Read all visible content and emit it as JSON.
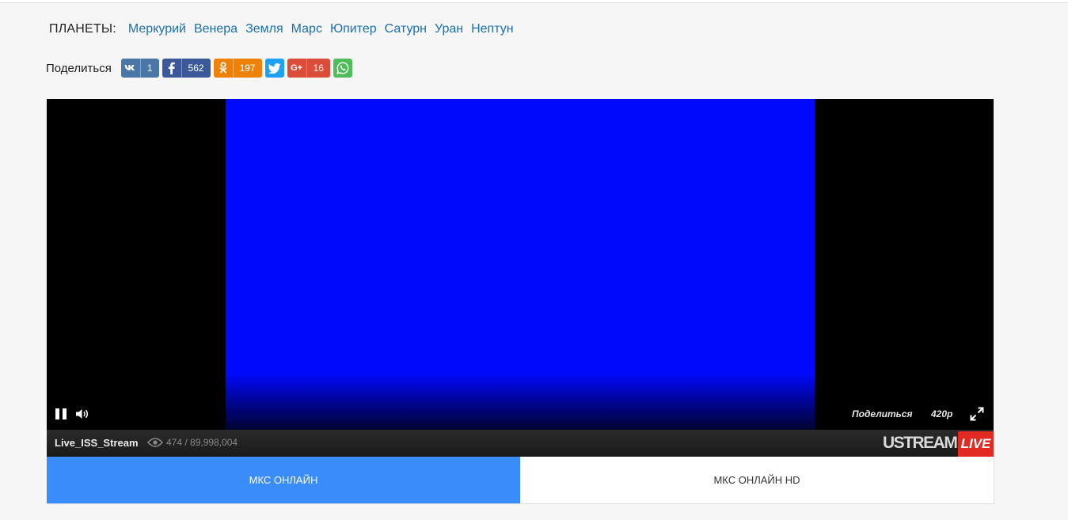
{
  "planets": {
    "label": "ПЛАНЕТЫ:",
    "items": [
      "Меркурий",
      "Венера",
      "Земля",
      "Марс",
      "Юпитер",
      "Сатурн",
      "Уран",
      "Нептун"
    ]
  },
  "share": {
    "label": "Поделиться",
    "vk": {
      "icon": "vk-icon",
      "count": "1"
    },
    "facebook": {
      "icon": "facebook-icon",
      "count": "562"
    },
    "odnoklassniki": {
      "icon": "odnoklassniki-icon",
      "count": "197"
    },
    "twitter": {
      "icon": "twitter-icon"
    },
    "googleplus": {
      "icon": "google-plus-icon",
      "glyph": "G+",
      "count": "16"
    },
    "whatsapp": {
      "icon": "whatsapp-icon"
    }
  },
  "player": {
    "share_label": "Поделиться",
    "quality": "420p",
    "stream_name": "Live_ISS_Stream",
    "viewers": "474 / 89,998,004",
    "brand": "USTREAM",
    "live_label": "LIVE"
  },
  "tabs": [
    {
      "label": "МКС ОНЛАЙН",
      "active": true
    },
    {
      "label": "МКС ОНЛАЙН HD",
      "active": false
    }
  ],
  "colors": {
    "link": "#1a6fb0",
    "tab_active": "#3b8cfb",
    "live_red": "#e02a22",
    "video_blue": "#0009fb"
  }
}
